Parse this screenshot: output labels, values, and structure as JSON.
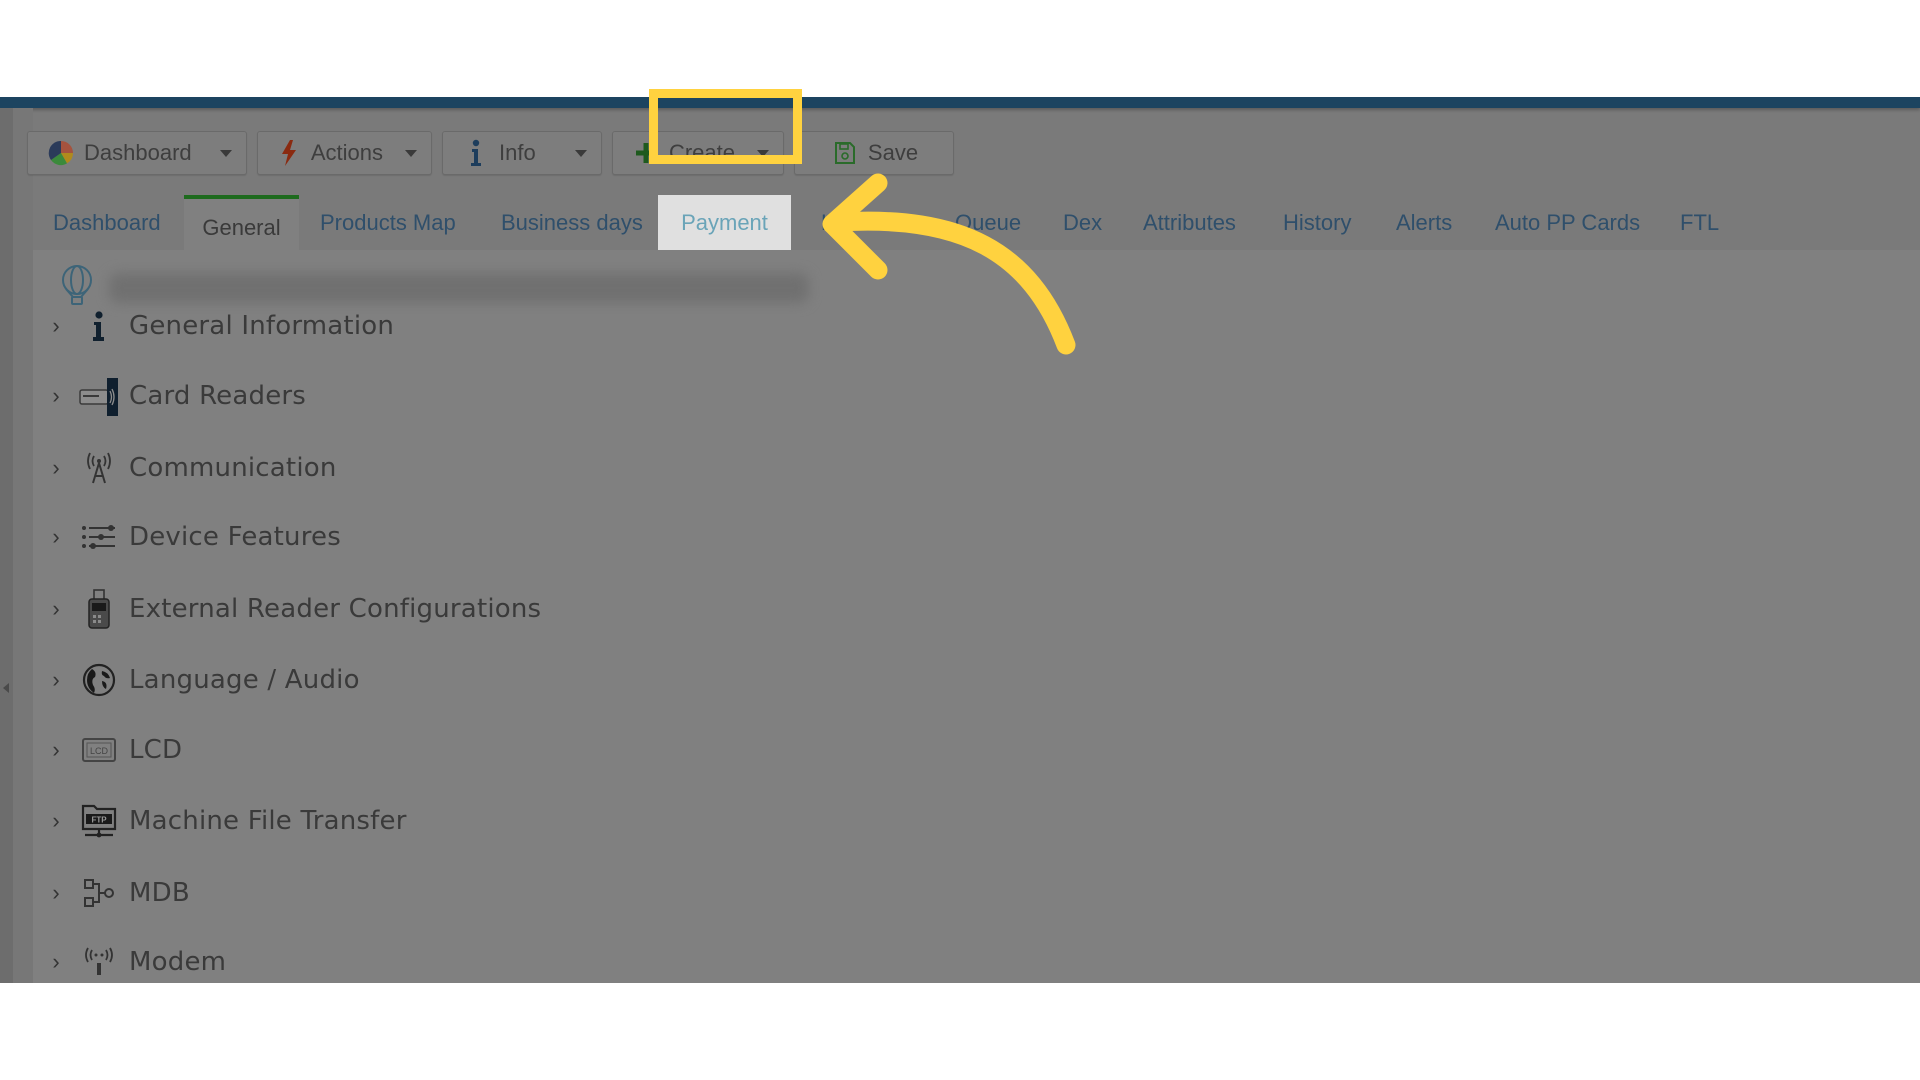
{
  "toolbar": {
    "buttons": [
      {
        "label": "Dashboard",
        "icon": "pie-chart-icon",
        "has_dropdown": true
      },
      {
        "label": "Actions",
        "icon": "lightning-icon",
        "has_dropdown": true
      },
      {
        "label": "Info",
        "icon": "info-icon",
        "has_dropdown": true
      },
      {
        "label": "Create",
        "icon": "plus-icon",
        "has_dropdown": true
      },
      {
        "label": "Save",
        "icon": "save-icon",
        "has_dropdown": false
      }
    ]
  },
  "tabs": {
    "active": "General",
    "highlighted": "Payment",
    "items": [
      {
        "label": "Dashboard"
      },
      {
        "label": "General"
      },
      {
        "label": "Products Map"
      },
      {
        "label": "Business days"
      },
      {
        "label": "Payment"
      },
      {
        "label": "K"
      },
      {
        "label": "Queue"
      },
      {
        "label": "Dex"
      },
      {
        "label": "Attributes"
      },
      {
        "label": "History"
      },
      {
        "label": "Alerts"
      },
      {
        "label": "Auto PP Cards"
      },
      {
        "label": "FTL"
      }
    ]
  },
  "content": {
    "header_icon": "balloon-icon",
    "sections": [
      {
        "label": "General Information",
        "icon": "info-icon"
      },
      {
        "label": "Card Readers",
        "icon": "card-reader-icon"
      },
      {
        "label": "Communication",
        "icon": "antenna-icon"
      },
      {
        "label": "Device Features",
        "icon": "sliders-icon"
      },
      {
        "label": "External Reader Configurations",
        "icon": "external-reader-icon"
      },
      {
        "label": "Language / Audio",
        "icon": "globe-icon"
      },
      {
        "label": "LCD",
        "icon": "lcd-icon"
      },
      {
        "label": "Machine File Transfer",
        "icon": "ftp-icon"
      },
      {
        "label": "MDB",
        "icon": "mdb-icon"
      },
      {
        "label": "Modem",
        "icon": "modem-icon"
      }
    ]
  },
  "annotation": {
    "color": "#ffd23f",
    "target": "Payment"
  },
  "colors": {
    "topbar": "#1c4460",
    "active_tab_border": "#1e6b1e",
    "tab_link": "#2f4f6b",
    "highlight": "#ffd23f"
  }
}
